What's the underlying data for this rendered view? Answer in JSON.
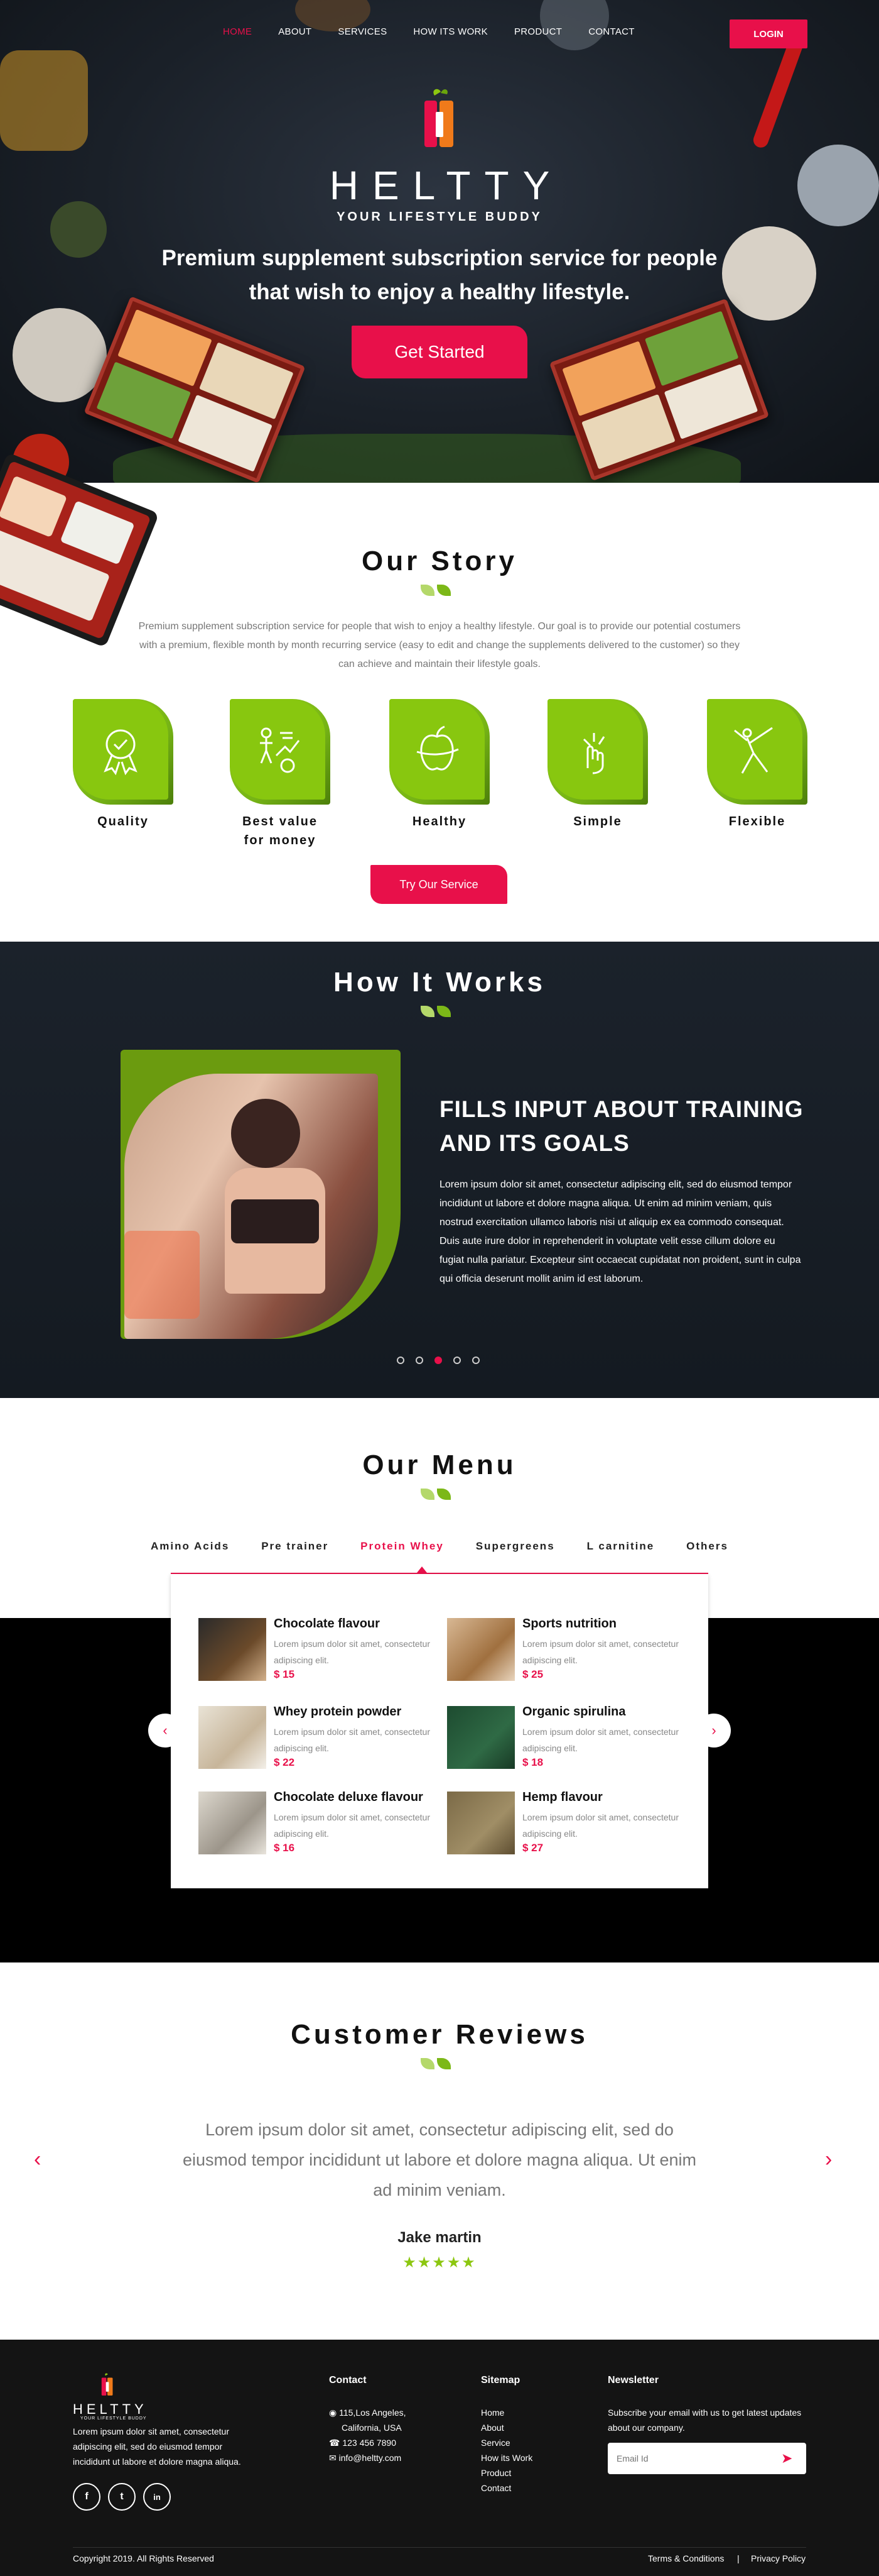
{
  "nav": {
    "items": [
      "HOME",
      "ABOUT",
      "SERVICES",
      "HOW ITS WORK",
      "PRODUCT",
      "CONTACT"
    ],
    "active": "HOME",
    "login": "LOGIN"
  },
  "hero": {
    "brand": "HELTTY",
    "tagline": "YOUR LIFESTYLE BUDDY",
    "headline_1": "Premium supplement subscription service for people",
    "headline_2": "that wish to enjoy a healthy lifestyle.",
    "cta": "Get Started"
  },
  "story": {
    "title": "Our Story",
    "text": "Premium supplement subscription service for people that wish to enjoy a healthy lifestyle. Our goal is to provide our potential costumers with a premium, flexible month by month recurring service (easy to edit and change the supplements delivered to the customer) so they can achieve and maintain their lifestyle goals.",
    "features": [
      {
        "label": "Quality",
        "icon": "ribbon-award-icon"
      },
      {
        "label": "Best value for money",
        "icon": "value-growth-icon"
      },
      {
        "label": "Healthy",
        "icon": "apple-tape-icon"
      },
      {
        "label": "Simple",
        "icon": "hand-gesture-icon"
      },
      {
        "label": "Flexible",
        "icon": "yoga-pose-icon"
      }
    ],
    "cta": "Try Our Service"
  },
  "how": {
    "title": "How It Works",
    "heading_1": "FILLS INPUT ABOUT TRAINING",
    "heading_2": "AND ITS GOALS",
    "text": "Lorem ipsum dolor sit amet, consectetur adipiscing elit, sed do eiusmod tempor incididunt ut labore et dolore magna aliqua. Ut enim ad minim veniam, quis nostrud exercitation ullamco laboris nisi ut aliquip ex ea commodo consequat. Duis aute irure dolor in reprehenderit in voluptate velit esse cillum dolore eu fugiat nulla pariatur. Excepteur sint occaecat cupidatat non proident, sunt in culpa qui officia deserunt mollit anim id est laborum.",
    "slides": 5,
    "active_slide": 3
  },
  "menu": {
    "title": "Our Menu",
    "tabs": [
      "Amino Acids",
      "Pre trainer",
      "Protein Whey",
      "Supergreens",
      "L carnitine",
      "Others"
    ],
    "active_tab": "Protein Whey",
    "items": [
      {
        "name": "Chocolate flavour",
        "desc": "Lorem ipsum dolor sit amet, consectetur adipiscing elit.",
        "price": "$ 15"
      },
      {
        "name": "Sports nutrition",
        "desc": "Lorem ipsum dolor sit amet, consectetur adipiscing elit.",
        "price": "$ 25"
      },
      {
        "name": "Whey protein powder",
        "desc": "Lorem ipsum dolor sit amet, consectetur adipiscing elit.",
        "price": "$ 22"
      },
      {
        "name": "Organic spirulina",
        "desc": "Lorem ipsum dolor sit amet, consectetur adipiscing elit.",
        "price": "$ 18"
      },
      {
        "name": "Chocolate deluxe flavour",
        "desc": "Lorem ipsum dolor sit amet, consectetur adipiscing elit.",
        "price": "$ 16"
      },
      {
        "name": "Hemp flavour",
        "desc": "Lorem ipsum dolor sit amet, consectetur adipiscing elit.",
        "price": "$ 27"
      }
    ]
  },
  "reviews": {
    "title": "Customer Reviews",
    "text": "Lorem ipsum dolor sit amet, consectetur adipiscing elit, sed do eiusmod tempor incididunt ut labore et dolore magna aliqua. Ut enim ad minim veniam.",
    "name": "Jake martin",
    "stars": 5
  },
  "footer": {
    "brand": "HELTTY",
    "tagline": "YOUR LIFESTYLE BUDDY",
    "about": "Lorem ipsum dolor sit amet, consectetur adipiscing elit, sed do eiusmod tempor incididunt ut labore et dolore magna aliqua.",
    "contact_title": "Contact",
    "address_1": "115,Los Angeles,",
    "address_2": "California, USA",
    "phone": "123 456 7890",
    "email": "info@heltty.com",
    "sitemap_title": "Sitemap",
    "sitemap": [
      "Home",
      "About",
      "Service",
      "How its Work",
      "Product",
      "Contact"
    ],
    "newsletter_title": "Newsletter",
    "newsletter_text": "Subscribe your email with us to get latest updates about our company.",
    "email_placeholder": "Email Id",
    "copyright": "Copyright 2019. All Rights Reserved",
    "terms": "Terms & Conditions",
    "separator": "|",
    "privacy": "Privacy Policy",
    "social": [
      "f",
      "t",
      "in"
    ]
  },
  "colors": {
    "accent": "#e8104a",
    "green": "#88c70f",
    "dark": "#141414"
  }
}
